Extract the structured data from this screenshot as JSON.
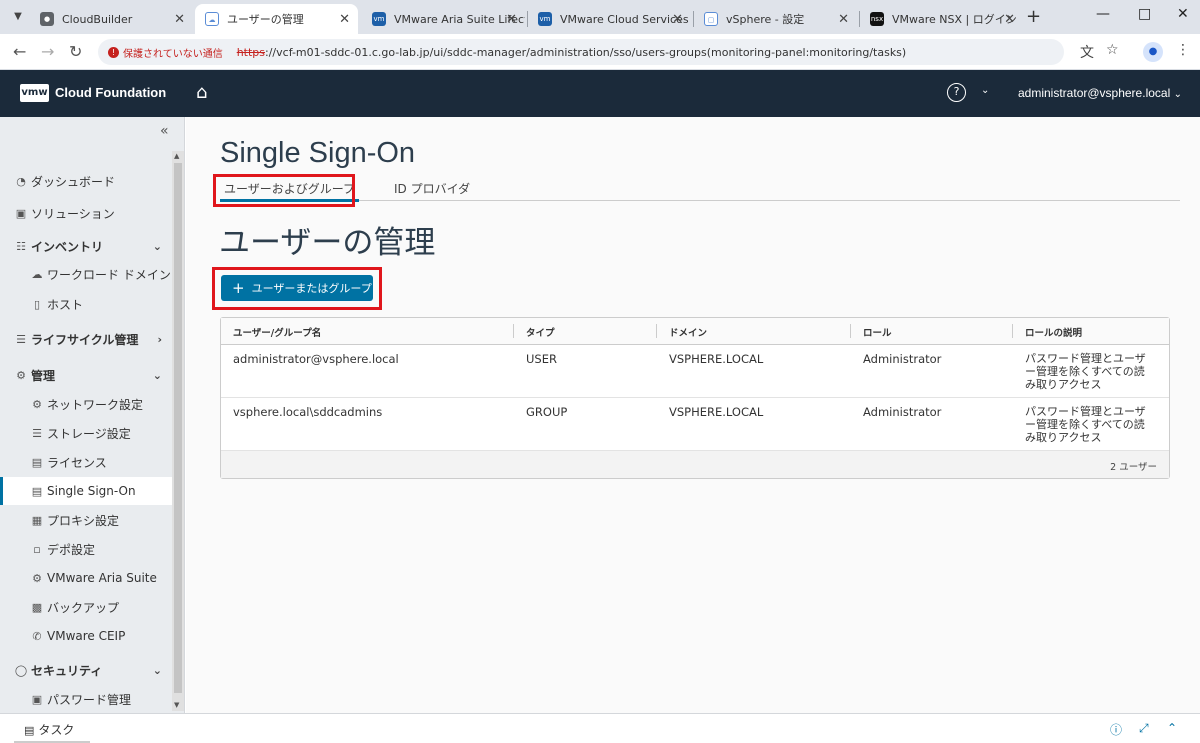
{
  "browser": {
    "tabs": [
      {
        "title": "CloudBuilder",
        "active": false
      },
      {
        "title": "ユーザーの管理",
        "active": true
      },
      {
        "title": "VMware Aria Suite Lifecyc",
        "active": false
      },
      {
        "title": "VMware Cloud Services",
        "active": false
      },
      {
        "title": "vSphere - 設定",
        "active": false
      },
      {
        "title": "VMware NSX | ログイン",
        "active": false
      }
    ],
    "security_label": "保護されていない通信",
    "url_scheme": "https",
    "url_rest": "://vcf-m01-sddc-01.c.go-lab.jp/ui/sddc-manager/administration/sso/users-groups(monitoring-panel:monitoring/tasks)"
  },
  "app": {
    "logo": "vmw",
    "brand": "Cloud Foundation",
    "user": "administrator@vsphere.local"
  },
  "sidebar": {
    "items": [
      {
        "label": "ダッシュボード",
        "icon": "dashboard-icon"
      },
      {
        "label": "ソリューション",
        "icon": "solutions-icon"
      },
      {
        "label": "インベントリ",
        "icon": "inventory-icon"
      },
      {
        "label": "ワークロード ドメイン",
        "icon": "workload-domain-icon"
      },
      {
        "label": "ホスト",
        "icon": "host-icon"
      },
      {
        "label": "ライフサイクル管理",
        "icon": "lifecycle-icon"
      },
      {
        "label": "管理",
        "icon": "admin-gear-icon"
      },
      {
        "label": "ネットワーク設定",
        "icon": "network-icon"
      },
      {
        "label": "ストレージ設定",
        "icon": "storage-icon"
      },
      {
        "label": "ライセンス",
        "icon": "license-icon"
      },
      {
        "label": "Single Sign-On",
        "icon": "sso-icon"
      },
      {
        "label": "プロキシ設定",
        "icon": "proxy-icon"
      },
      {
        "label": "デポ設定",
        "icon": "depot-icon"
      },
      {
        "label": "VMware Aria Suite",
        "icon": "aria-icon"
      },
      {
        "label": "バックアップ",
        "icon": "backup-icon"
      },
      {
        "label": "VMware CEIP",
        "icon": "ceip-phone-icon"
      },
      {
        "label": "セキュリティ",
        "icon": "security-shield-icon"
      },
      {
        "label": "パスワード管理",
        "icon": "lock-icon"
      }
    ],
    "active": "Single Sign-On"
  },
  "main": {
    "title": "Single Sign-On",
    "tabs": [
      "ユーザーおよびグループ",
      "ID プロバイダ"
    ],
    "active_tab": "ユーザーおよびグループ",
    "section_title": "ユーザーの管理",
    "add_button": "ユーザーまたはグループ",
    "table": {
      "columns": [
        "ユーザー/グループ名",
        "タイプ",
        "ドメイン",
        "ロール",
        "ロールの説明"
      ],
      "rows": [
        {
          "name": "administrator@vsphere.local",
          "type": "USER",
          "domain": "VSPHERE.LOCAL",
          "role": "Administrator",
          "desc": [
            "パスワード管理とユーザ",
            "ー管理を除くすべての読",
            "み取りアクセス"
          ]
        },
        {
          "name": "vsphere.local\\sddcadmins",
          "type": "GROUP",
          "domain": "VSPHERE.LOCAL",
          "role": "Administrator",
          "desc": [
            "パスワード管理とユーザ",
            "ー管理を除くすべての読",
            "み取りアクセス"
          ]
        }
      ],
      "footer": "2 ユーザー"
    }
  },
  "taskbar": {
    "label": "タスク"
  },
  "colors": {
    "header_bg": "#1b2a3a",
    "accent": "#0072a3",
    "highlight": "#e0161c"
  }
}
